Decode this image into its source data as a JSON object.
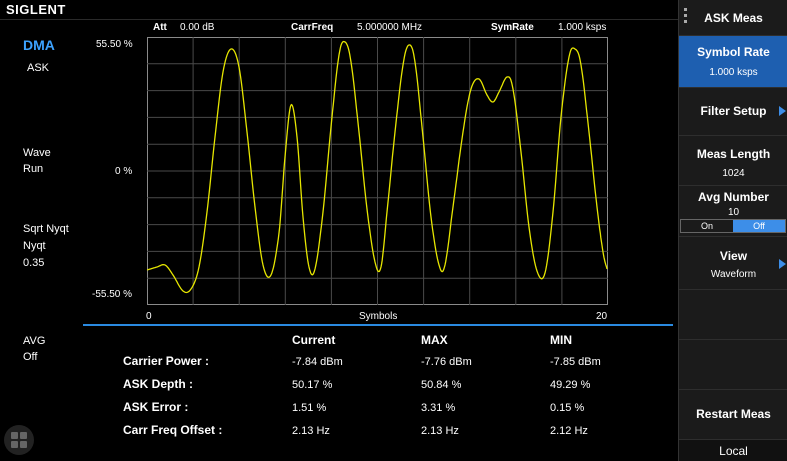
{
  "brand": "SIGLENT",
  "mode": {
    "title": "DMA",
    "modulation": "ASK"
  },
  "status": {
    "wave_label": "Wave",
    "wave_value": "Run",
    "filter_label": "Sqrt Nyqt",
    "filter_label2": "Nyqt",
    "filter_value": "0.35",
    "avg_label": "AVG",
    "avg_value": "Off"
  },
  "header": {
    "att_label": "Att",
    "att_value": "0.00 dB",
    "carrfreq_label": "CarrFreq",
    "carrfreq_value": "5.000000 MHz",
    "symrate_label": "SymRate",
    "symrate_value": "1.000 ksps"
  },
  "plot": {
    "y_top": "55.50 %",
    "y_mid": "0 %",
    "y_bottom": "-55.50 %",
    "x_start": "0",
    "x_end": "20",
    "x_label": "Symbols",
    "trace_color": "#e6e600",
    "grid_color": "#4a4a4a"
  },
  "results": {
    "col_current": "Current",
    "col_max": "MAX",
    "col_min": "MIN",
    "rows": [
      {
        "label": "Carrier Power :",
        "current": "-7.84 dBm",
        "max": "-7.76 dBm",
        "min": "-7.85 dBm"
      },
      {
        "label": "ASK Depth :",
        "current": "50.17 %",
        "max": "50.84 %",
        "min": "49.29 %"
      },
      {
        "label": "ASK Error :",
        "current": "1.51 %",
        "max": "3.31 %",
        "min": "0.15 %"
      },
      {
        "label": "Carr Freq Offset :",
        "current": "2.13 Hz",
        "max": "2.13 Hz",
        "min": "2.12 Hz"
      }
    ]
  },
  "menu": {
    "title": "ASK Meas",
    "symbol_rate_label": "Symbol Rate",
    "symbol_rate_value": "1.000 ksps",
    "filter_setup_label": "Filter Setup",
    "meas_length_label": "Meas Length",
    "meas_length_value": "1024",
    "avg_number_label": "Avg Number",
    "avg_number_value": "10",
    "avg_on": "On",
    "avg_off": "Off",
    "view_label": "View",
    "view_value": "Waveform",
    "restart_label": "Restart Meas",
    "local_label": "Local",
    "accent_color": "#1e5fb0"
  }
}
